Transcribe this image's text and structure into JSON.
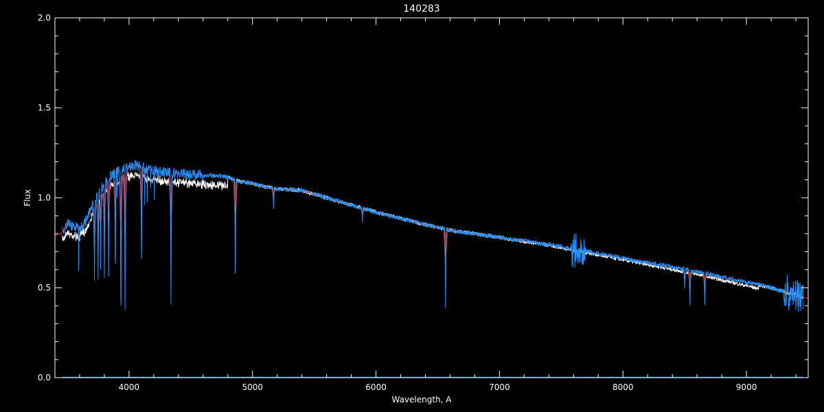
{
  "chart_data": {
    "type": "line",
    "title": "140283",
    "xlabel": "Wavelength, A",
    "ylabel": "Flux",
    "xlim": [
      3400,
      9500
    ],
    "ylim": [
      0,
      2.0
    ],
    "x_ticks": [
      4000,
      5000,
      6000,
      7000,
      8000,
      9000
    ],
    "x_tick_labels": [
      "4000",
      "5000",
      "6000",
      "7000",
      "8000",
      "9000"
    ],
    "x_minor_step": 200,
    "y_ticks": [
      0,
      0.5,
      1.0,
      1.5,
      2.0
    ],
    "y_tick_labels": [
      "0.0",
      "0.5",
      "1.0",
      "1.5",
      "2.0"
    ],
    "y_minor_step": 0.1,
    "grid": false,
    "colors": {
      "background": "#000000",
      "axes": "#ffffff",
      "observed": "#ffffff",
      "model": "#cc2222",
      "fit": "#1e90ff"
    },
    "continuum": {
      "x": [
        3400,
        3450,
        3500,
        3550,
        3600,
        3650,
        3700,
        3750,
        3800,
        3850,
        3900,
        3950,
        4000,
        4050,
        4100,
        4200,
        4300,
        4400,
        4500,
        4600,
        4700,
        4800,
        4900,
        5000,
        5100,
        5200,
        5300,
        5400,
        5500,
        5600,
        5800,
        6000,
        6200,
        6400,
        6600,
        6800,
        7000,
        7200,
        7400,
        7600,
        7800,
        8000,
        8200,
        8400,
        8600,
        8800,
        9000,
        9200,
        9400,
        9500
      ],
      "y": [
        0.79,
        0.8,
        0.86,
        0.84,
        0.83,
        0.87,
        0.95,
        1.02,
        1.08,
        1.12,
        1.14,
        1.16,
        1.17,
        1.18,
        1.17,
        1.15,
        1.14,
        1.135,
        1.13,
        1.125,
        1.12,
        1.115,
        1.09,
        1.08,
        1.06,
        1.05,
        1.045,
        1.04,
        1.02,
        1.0,
        0.96,
        0.92,
        0.885,
        0.85,
        0.82,
        0.8,
        0.78,
        0.76,
        0.74,
        0.715,
        0.69,
        0.665,
        0.64,
        0.615,
        0.59,
        0.56,
        0.53,
        0.5,
        0.46,
        0.44
      ]
    },
    "absorption_lines": [
      {
        "x": 3720,
        "depth": 0.45
      },
      {
        "x": 3750,
        "depth": 0.5
      },
      {
        "x": 3770,
        "depth": 0.45
      },
      {
        "x": 3800,
        "depth": 0.55
      },
      {
        "x": 3835,
        "depth": 0.55
      },
      {
        "x": 3889,
        "depth": 0.6
      },
      {
        "x": 3934,
        "depth": 0.9
      },
      {
        "x": 3968,
        "depth": 0.85
      },
      {
        "x": 4101,
        "depth": 0.6
      },
      {
        "x": 4340,
        "depth": 0.8
      },
      {
        "x": 4861,
        "depth": 0.62
      },
      {
        "x": 5170,
        "depth": 0.12
      },
      {
        "x": 5890,
        "depth": 0.08
      },
      {
        "x": 6563,
        "depth": 0.47
      },
      {
        "x": 8500,
        "depth": 0.1
      },
      {
        "x": 8542,
        "depth": 0.22
      },
      {
        "x": 8662,
        "depth": 0.18
      }
    ],
    "series": [
      {
        "style": "observed"
      },
      {
        "style": "model"
      },
      {
        "style": "fit"
      }
    ]
  }
}
